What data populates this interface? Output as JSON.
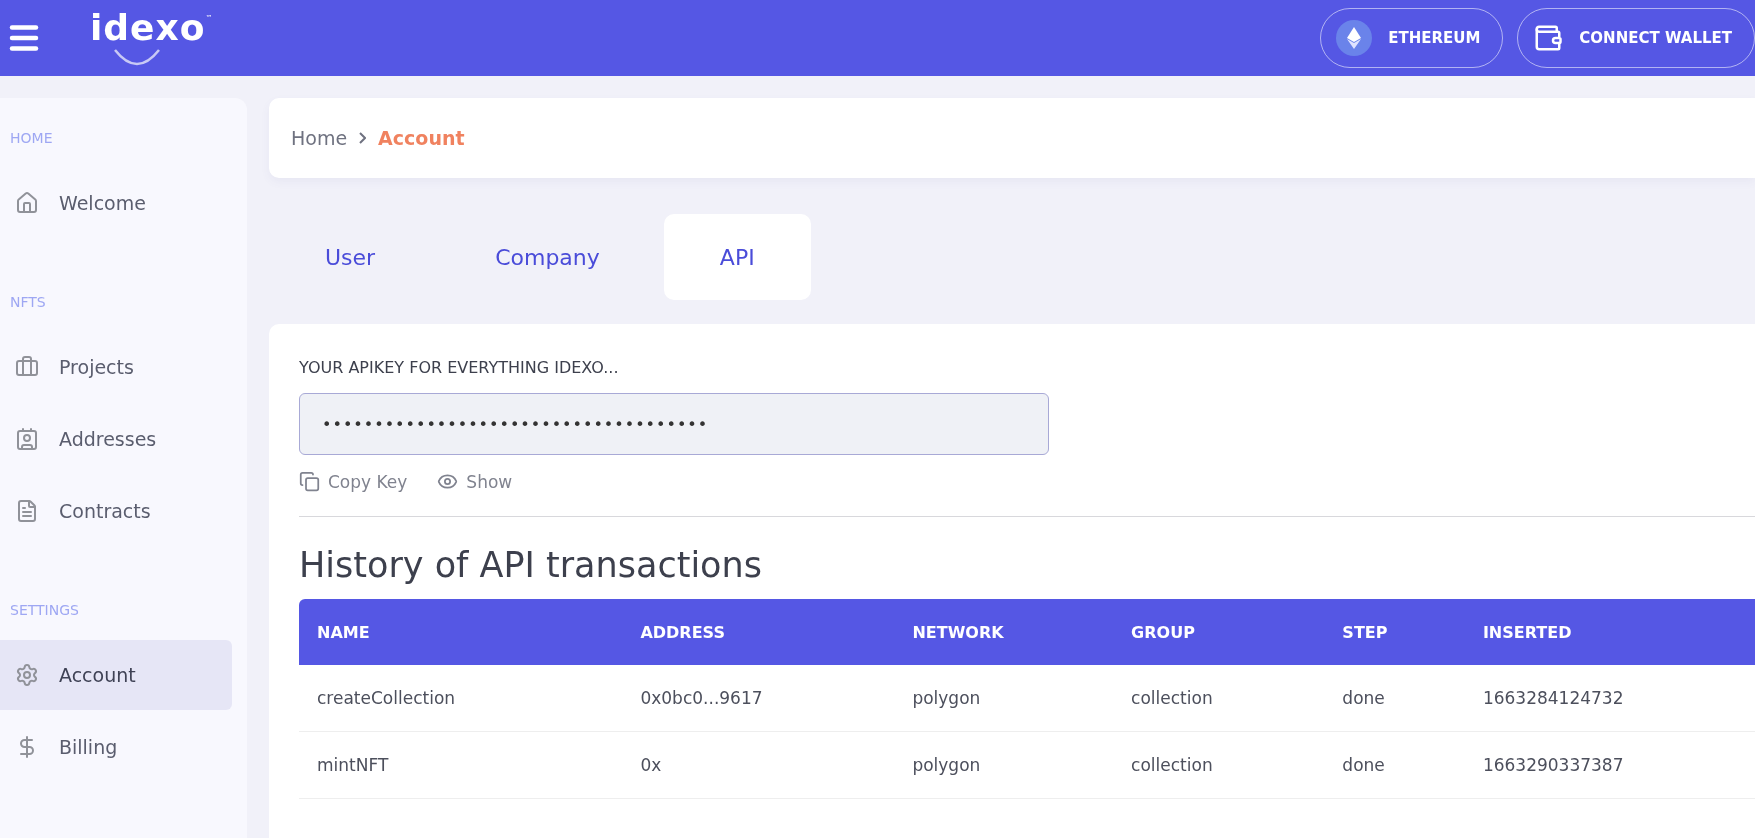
{
  "header": {
    "logo": "idexo",
    "logo_mark": "™",
    "network_button": "ETHEREUM",
    "wallet_button": "CONNECT WALLET"
  },
  "sidebar": {
    "sections": [
      {
        "title": "HOME",
        "items": [
          {
            "label": "Welcome",
            "selected": false
          }
        ]
      },
      {
        "title": "NFTS",
        "items": [
          {
            "label": "Projects",
            "selected": false
          },
          {
            "label": "Addresses",
            "selected": false
          },
          {
            "label": "Contracts",
            "selected": false
          }
        ]
      },
      {
        "title": "SETTINGS",
        "items": [
          {
            "label": "Account",
            "selected": true
          },
          {
            "label": "Billing",
            "selected": false
          }
        ]
      }
    ]
  },
  "breadcrumb": [
    {
      "label": "Home",
      "current": false
    },
    {
      "label": "Account",
      "current": true
    }
  ],
  "tabs": [
    {
      "label": "User",
      "selected": false
    },
    {
      "label": "Company",
      "selected": false
    },
    {
      "label": "API",
      "selected": true
    }
  ],
  "api_key": {
    "label": "YOUR APIKEY FOR EVERYTHING IDEXO...",
    "value": "•••••••••••••••••••••••••••••••••••••",
    "actions": [
      {
        "kind": "copy",
        "label": "Copy Key"
      },
      {
        "kind": "show",
        "label": "Show"
      }
    ]
  },
  "history": {
    "title": "History of API transactions",
    "columns": [
      "NAME",
      "ADDRESS",
      "NETWORK",
      "GROUP",
      "STEP",
      "INSERTED"
    ],
    "rows": [
      [
        "createCollection",
        "0x0bc0...9617",
        "polygon",
        "collection",
        "done",
        "1663284124732"
      ],
      [
        "mintNFT",
        "0x",
        "polygon",
        "collection",
        "done",
        "1663290337387"
      ]
    ]
  }
}
